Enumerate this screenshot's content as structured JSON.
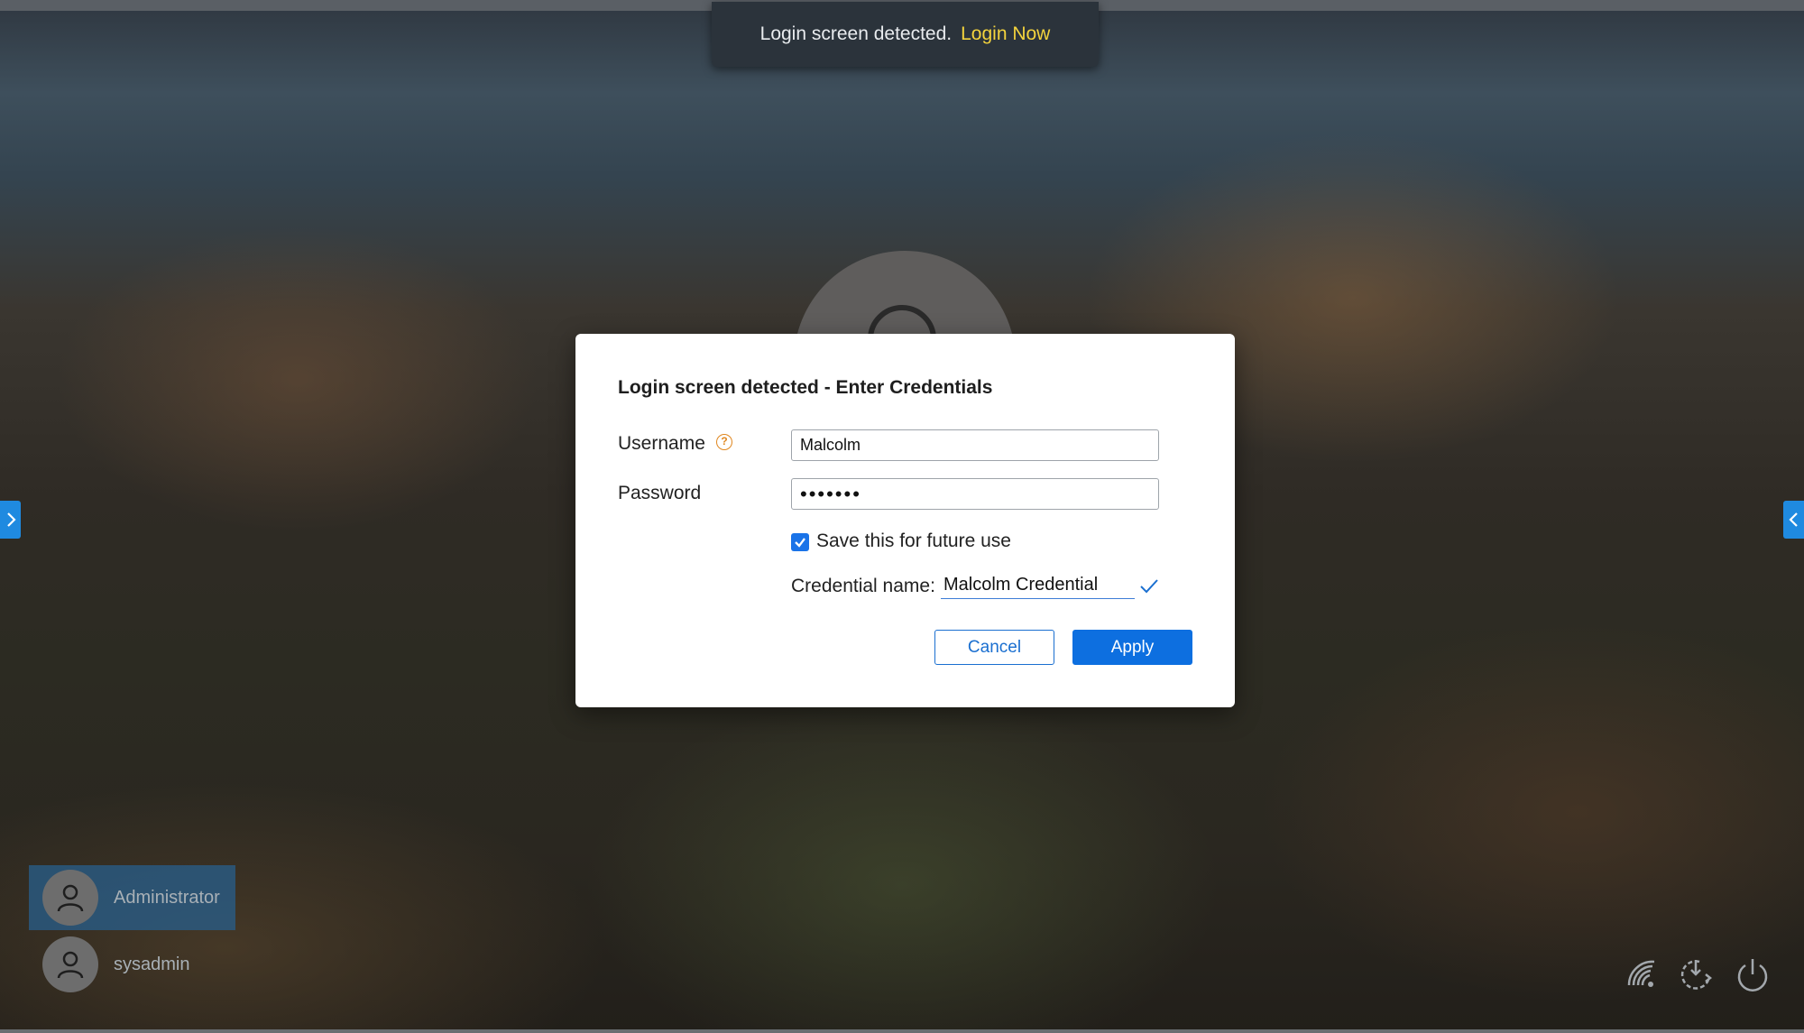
{
  "toast": {
    "message": "Login screen detected.",
    "action_label": "Login Now"
  },
  "dialog": {
    "title": "Login screen detected - Enter Credentials",
    "username_label": "Username",
    "username_value": "Malcolm",
    "password_label": "Password",
    "password_value": "•••••••",
    "save_label": "Save this for future use",
    "save_checked": true,
    "credential_name_label": "Credential name:",
    "credential_name_value": "Malcolm Credential",
    "cancel_label": "Cancel",
    "apply_label": "Apply"
  },
  "users": [
    {
      "name": "Administrator",
      "selected": true
    },
    {
      "name": "sysadmin",
      "selected": false
    }
  ],
  "icons": {
    "left_tab": "chevron-right-icon",
    "right_tab": "chevron-left-icon",
    "help": "question-circle-icon",
    "system": [
      "network-icon",
      "restart-icon",
      "power-icon"
    ]
  },
  "colors": {
    "accent": "#0d6fe0",
    "toast_link": "#f3d33d",
    "help_icon": "#e0871f",
    "side_tab": "#1f8ae0"
  }
}
